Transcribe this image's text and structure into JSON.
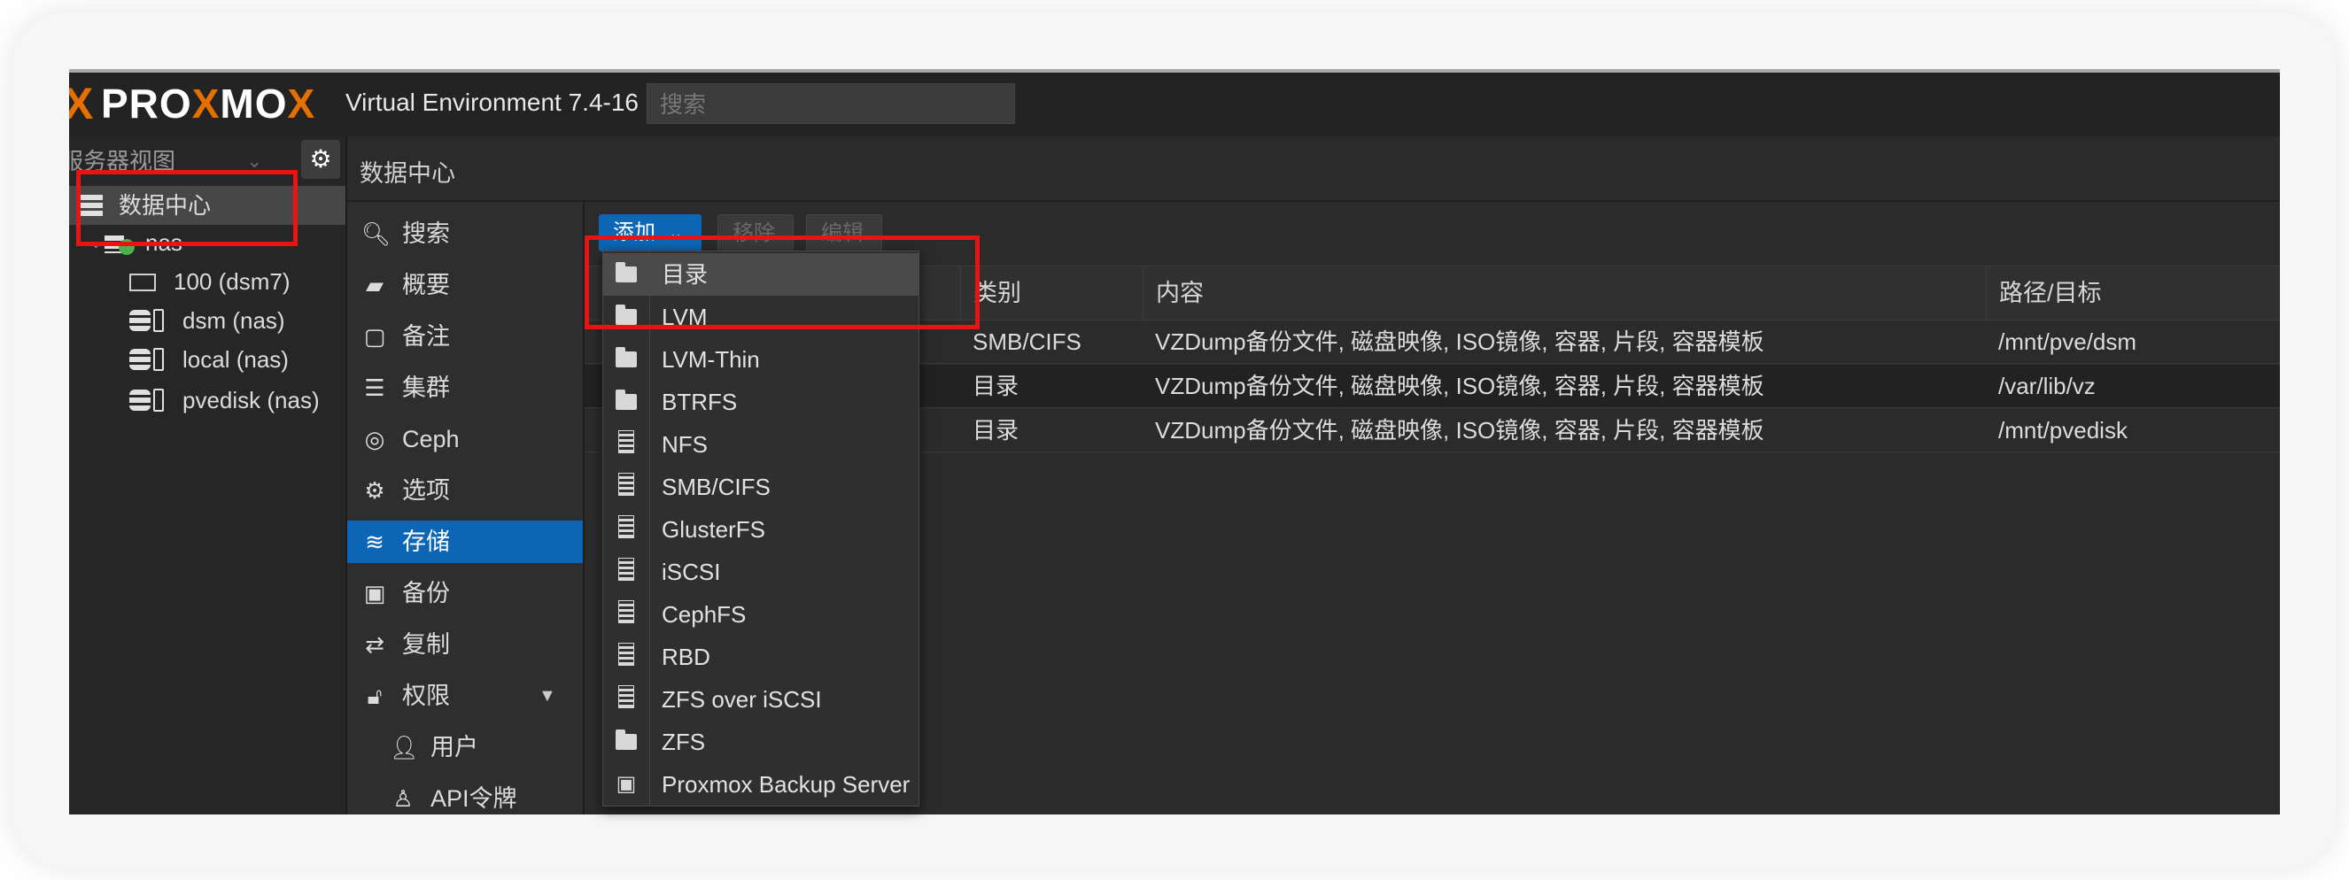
{
  "header": {
    "logo_x": "X",
    "logo_text_a": "PRO",
    "logo_text_x": "X",
    "logo_text_b": "MO",
    "logo_text_x2": "X",
    "version": "Virtual Environment 7.4-16",
    "search_placeholder": "搜索"
  },
  "tree": {
    "view": "服务器视图",
    "items": [
      {
        "label": "数据中心",
        "icon": "datacenter-icon"
      },
      {
        "label": "nas",
        "icon": "node-icon"
      },
      {
        "label": "100 (dsm7)",
        "icon": "monitor-icon"
      },
      {
        "label": "dsm (nas)",
        "icon": "storage-icon"
      },
      {
        "label": "local (nas)",
        "icon": "storage-icon"
      },
      {
        "label": "pvedisk (nas)",
        "icon": "storage-icon"
      }
    ]
  },
  "breadcrumb": "数据中心",
  "menu": {
    "items": [
      {
        "label": "搜索",
        "icon": "search-icon"
      },
      {
        "label": "概要",
        "icon": "book-icon"
      },
      {
        "label": "备注",
        "icon": "note-icon"
      },
      {
        "label": "集群",
        "icon": "server-icon"
      },
      {
        "label": "Ceph",
        "icon": "ceph-icon"
      },
      {
        "label": "选项",
        "icon": "gear-icon"
      },
      {
        "label": "存储",
        "icon": "database-icon"
      },
      {
        "label": "备份",
        "icon": "floppy-icon"
      },
      {
        "label": "复制",
        "icon": "retweet-icon"
      },
      {
        "label": "权限",
        "icon": "unlock-icon"
      },
      {
        "label": "用户",
        "icon": "user-icon"
      },
      {
        "label": "API令牌",
        "icon": "user-outline-icon"
      }
    ]
  },
  "toolbar": {
    "add": "添加",
    "remove": "移除",
    "edit": "编辑"
  },
  "grid": {
    "columns": [
      "类别",
      "内容",
      "路径/目标"
    ],
    "rows": [
      {
        "type": "SMB/CIFS",
        "content": "VZDump备份文件, 磁盘映像, ISO镜像, 容器, 片段, 容器模板",
        "path": "/mnt/pve/dsm"
      },
      {
        "type": "目录",
        "content": "VZDump备份文件, 磁盘映像, ISO镜像, 容器, 片段, 容器模板",
        "path": "/var/lib/vz"
      },
      {
        "type": "目录",
        "content": "VZDump备份文件, 磁盘映像, ISO镜像, 容器, 片段, 容器模板",
        "path": "/mnt/pvedisk"
      }
    ]
  },
  "dropdown": {
    "items": [
      {
        "label": "目录",
        "icon": "folder-icon"
      },
      {
        "label": "LVM",
        "icon": "folder-icon"
      },
      {
        "label": "LVM-Thin",
        "icon": "folder-icon"
      },
      {
        "label": "BTRFS",
        "icon": "folder-icon"
      },
      {
        "label": "NFS",
        "icon": "building-icon"
      },
      {
        "label": "SMB/CIFS",
        "icon": "building-icon"
      },
      {
        "label": "GlusterFS",
        "icon": "building-icon"
      },
      {
        "label": "iSCSI",
        "icon": "building-icon"
      },
      {
        "label": "CephFS",
        "icon": "building-icon"
      },
      {
        "label": "RBD",
        "icon": "building-icon"
      },
      {
        "label": "ZFS over iSCSI",
        "icon": "building-icon"
      },
      {
        "label": "ZFS",
        "icon": "folder-icon"
      },
      {
        "label": "Proxmox Backup Server",
        "icon": "floppy-icon"
      }
    ]
  },
  "colors": {
    "accent": "#0d66b5",
    "brand": "#e57000",
    "highlight_box": "#e81414"
  }
}
